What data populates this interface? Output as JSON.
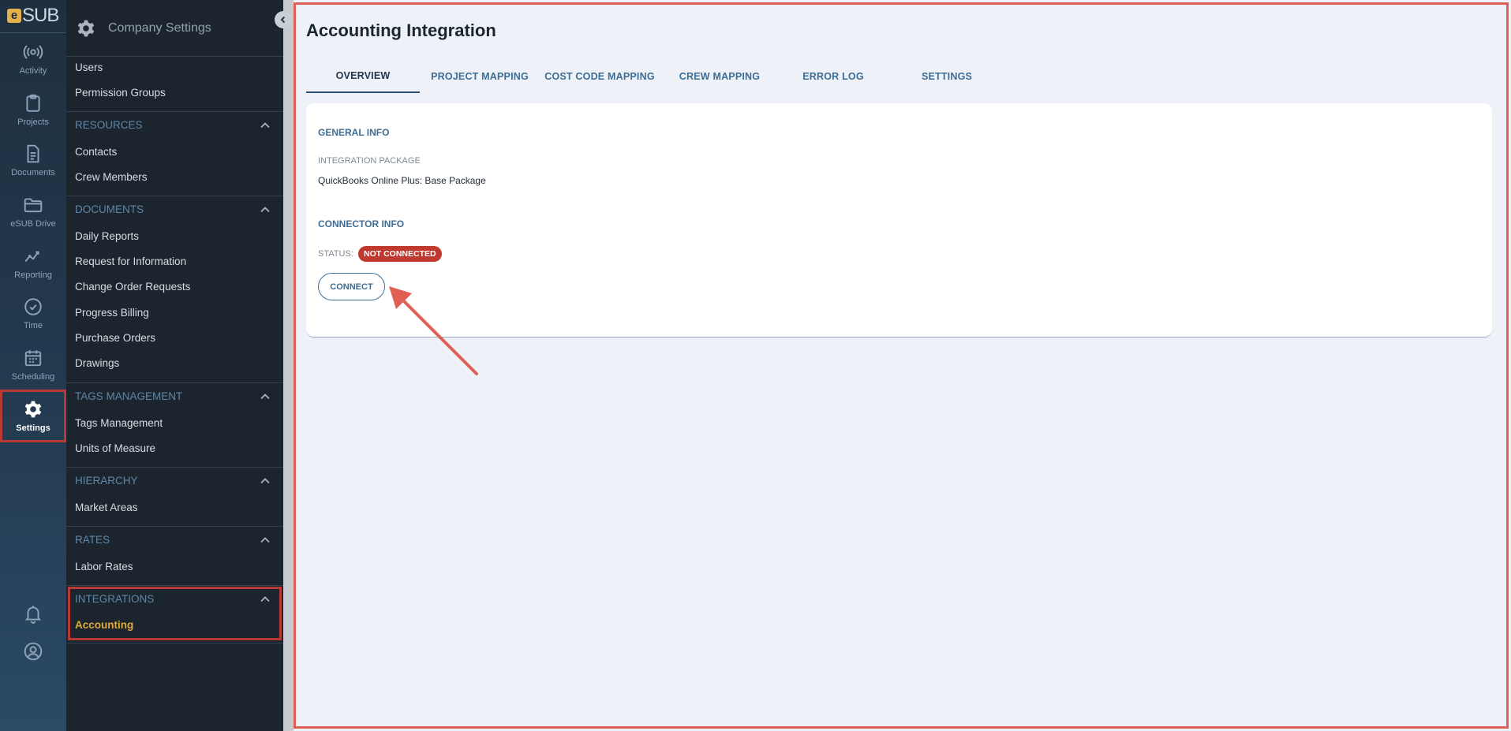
{
  "app": {
    "logo_mark": "e",
    "logo_text": "SUB"
  },
  "rail": {
    "items": [
      {
        "label": "Activity",
        "icon": "activity-icon"
      },
      {
        "label": "Projects",
        "icon": "clipboard-icon"
      },
      {
        "label": "Documents",
        "icon": "document-icon"
      },
      {
        "label": "eSUB Drive",
        "icon": "folder-icon"
      },
      {
        "label": "Reporting",
        "icon": "chart-icon"
      },
      {
        "label": "Time",
        "icon": "clock-icon"
      },
      {
        "label": "Scheduling",
        "icon": "calendar-icon"
      },
      {
        "label": "Settings",
        "icon": "gear-icon",
        "active": true
      }
    ],
    "bottom": [
      {
        "icon": "bell-icon"
      },
      {
        "icon": "user-icon"
      }
    ]
  },
  "sidebar": {
    "title": "Company Settings",
    "top_links": [
      "Users",
      "Permission Groups"
    ],
    "sections": [
      {
        "title": "RESOURCES",
        "items": [
          "Contacts",
          "Crew Members"
        ]
      },
      {
        "title": "DOCUMENTS",
        "items": [
          "Daily Reports",
          "Request for Information",
          "Change Order Requests",
          "Progress Billing",
          "Purchase Orders",
          "Drawings"
        ]
      },
      {
        "title": "TAGS MANAGEMENT",
        "items": [
          "Tags Management",
          "Units of Measure"
        ]
      },
      {
        "title": "HIERARCHY",
        "items": [
          "Market Areas"
        ]
      },
      {
        "title": "RATES",
        "items": [
          "Labor Rates"
        ]
      },
      {
        "title": "INTEGRATIONS",
        "items": [
          "Accounting"
        ]
      }
    ]
  },
  "main": {
    "title": "Accounting Integration",
    "tabs": [
      "OVERVIEW",
      "PROJECT MAPPING",
      "COST CODE MAPPING",
      "CREW MAPPING",
      "ERROR LOG",
      "SETTINGS"
    ],
    "active_tab": "OVERVIEW",
    "general_info": {
      "title": "GENERAL INFO",
      "package_label": "INTEGRATION PACKAGE",
      "package_value": "QuickBooks Online Plus: Base Package"
    },
    "connector_info": {
      "title": "CONNECTOR INFO",
      "status_label": "STATUS:",
      "status_value": "NOT CONNECTED",
      "connect_label": "CONNECT"
    }
  },
  "colors": {
    "accent": "#3d6d94",
    "status_error": "#c0392f",
    "active_link": "#e0a93b",
    "annotation": "#e06055"
  }
}
